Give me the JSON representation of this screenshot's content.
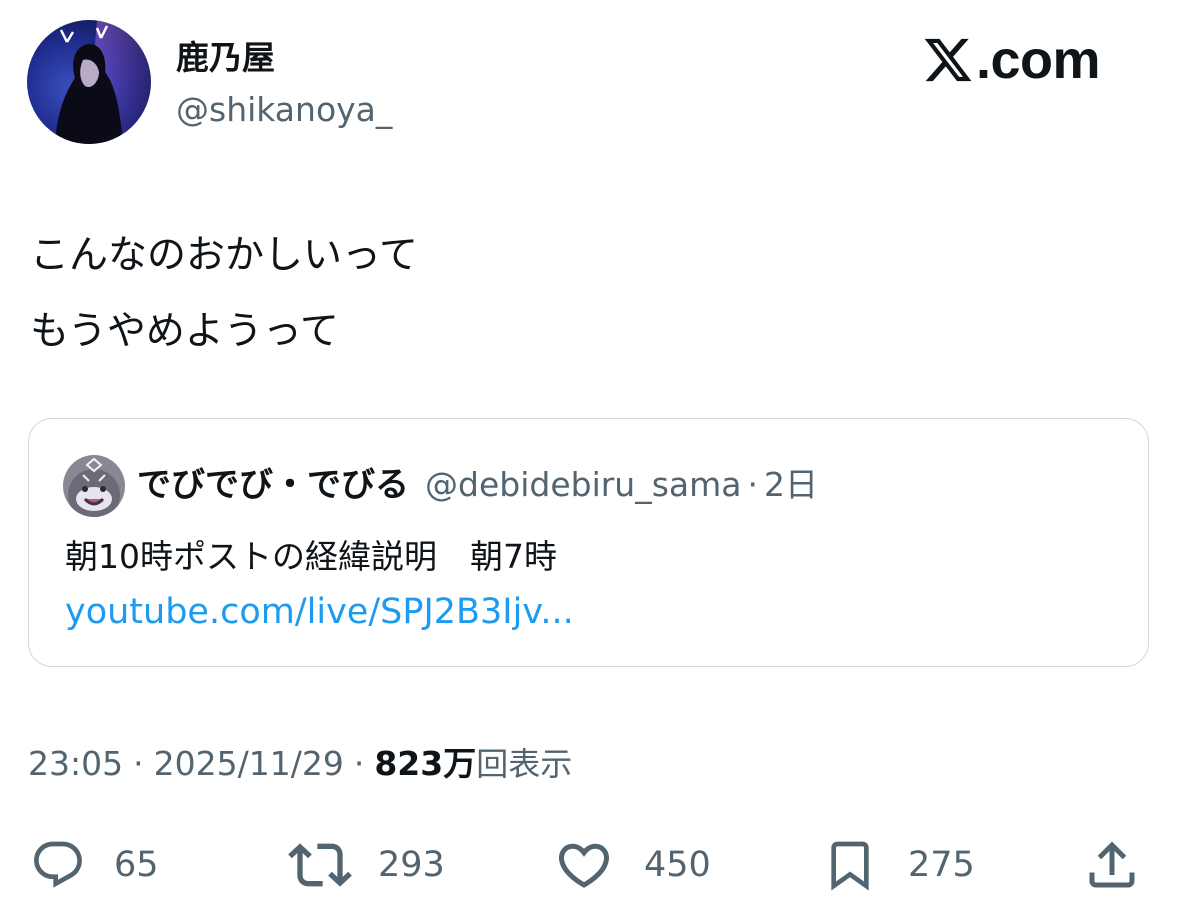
{
  "author": {
    "display_name": "鹿乃屋",
    "handle": "@shikanoya_"
  },
  "brand": {
    "text": ".com"
  },
  "tweet": {
    "lines": [
      "こんなのおかしいって",
      "もうやめようって"
    ]
  },
  "quote": {
    "display_name": "でびでび・でびる",
    "handle": "@debidebiru_sama",
    "dot": "·",
    "time": "2日",
    "text": "朝10時ポストの経緯説明　朝7時",
    "link": "youtube.com/live/SPJ2B3Ijv..."
  },
  "meta": {
    "time": "23:05",
    "sep": "·",
    "date": "2025/11/29",
    "views_count": "823万",
    "views_label": "回表示"
  },
  "actions": {
    "replies": "65",
    "reposts": "293",
    "likes": "450",
    "bookmarks": "275"
  },
  "colors": {
    "text": "#0f1419",
    "secondary": "#536471",
    "link": "#1d9bf0",
    "border": "#cfd9de"
  }
}
